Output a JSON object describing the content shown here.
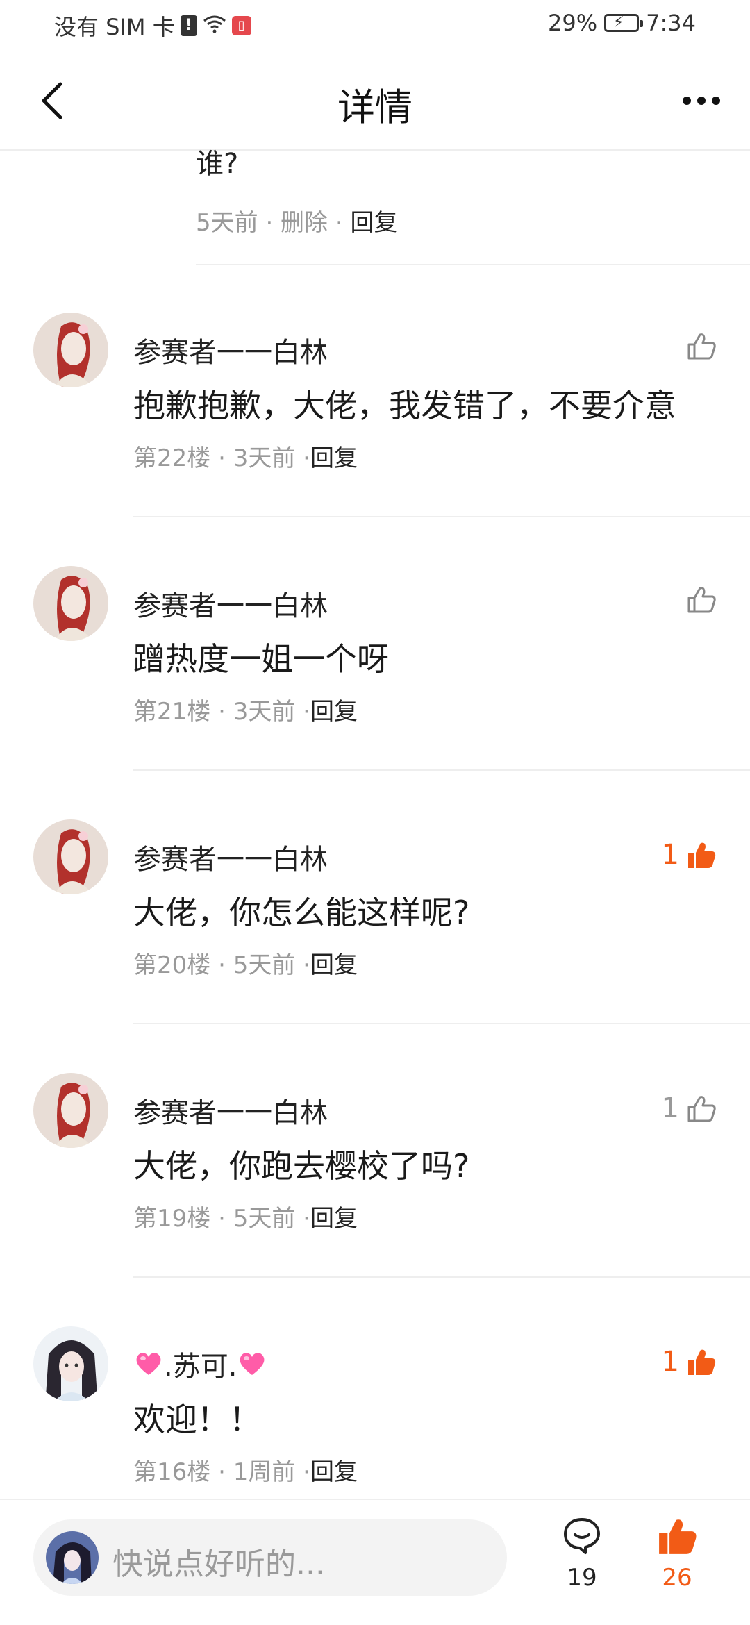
{
  "status": {
    "carrier": "没有 SIM 卡",
    "battery": "29%",
    "time": "7:34",
    "icons": [
      "alert-icon",
      "wifi-icon",
      "book-icon",
      "battery-icon"
    ]
  },
  "header": {
    "title": "详情",
    "back_icon": "back-chevron-icon",
    "more_icon": "more-dots-icon"
  },
  "partial_reply": {
    "text_fragment": "谁?",
    "meta_time": "5天前 · 删除 · ",
    "reply_label": "回复"
  },
  "comments": [
    {
      "username": "参赛者一一白林",
      "content": "抱歉抱歉，大佬，我发错了，不要介意",
      "floor": "第22楼",
      "time": "3天前",
      "reply": "回复",
      "likes": "",
      "liked": false
    },
    {
      "username": "参赛者一一白林",
      "content": "蹭热度一姐一个呀",
      "floor": "第21楼",
      "time": "3天前",
      "reply": "回复",
      "likes": "",
      "liked": false
    },
    {
      "username": "参赛者一一白林",
      "content": "大佬，你怎么能这样呢?",
      "floor": "第20楼",
      "time": "5天前",
      "reply": "回复",
      "likes": "1",
      "liked": true
    },
    {
      "username": "参赛者一一白林",
      "content": "大佬，你跑去樱校了吗?",
      "floor": "第19楼",
      "time": "5天前",
      "reply": "回复",
      "likes": "1",
      "liked": false
    },
    {
      "username": ".苏可.",
      "content": "欢迎！！",
      "floor": "第16楼",
      "time": "1周前",
      "reply": "回复",
      "likes": "1",
      "liked": true
    }
  ],
  "bottom": {
    "placeholder": "快说点好听的...",
    "comment_count": "19",
    "like_count": "26"
  },
  "colors": {
    "accent": "#f25b16",
    "muted": "#999999",
    "divider": "#eeeeee"
  }
}
